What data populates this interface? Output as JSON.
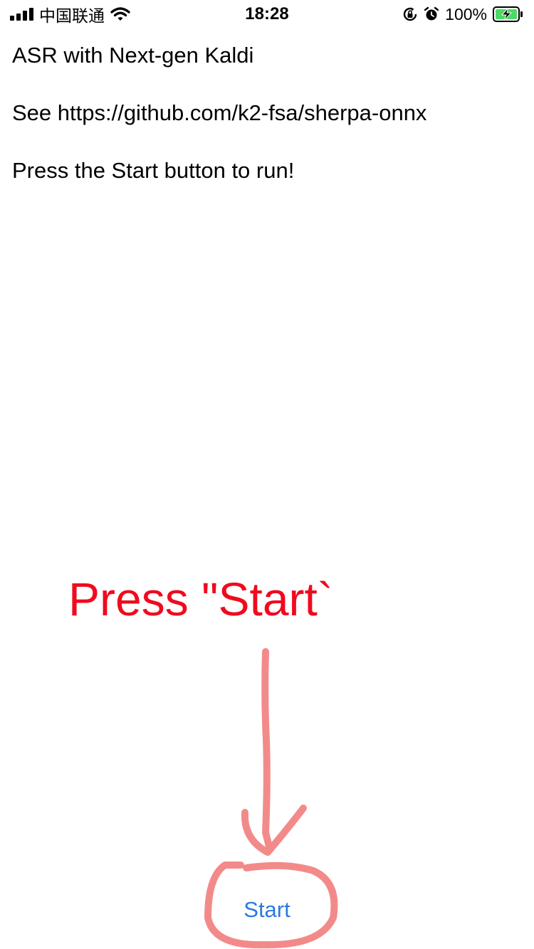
{
  "status_bar": {
    "carrier": "中国联通",
    "time": "18:28",
    "battery_percent": "100%",
    "icons": [
      "signal-bars-icon",
      "wifi-icon",
      "orientation-lock-icon",
      "alarm-icon",
      "battery-charging-icon"
    ]
  },
  "content": {
    "title": "ASR with Next-gen Kaldi",
    "link_line": "See https://github.com/k2-fsa/sherpa-onnx",
    "instruction": "Press the Start button to run!"
  },
  "annotation": {
    "text": "Press \"Start`",
    "color": "#f00a1e",
    "stroke_color": "#f38a8a"
  },
  "start_button": {
    "label": "Start",
    "color": "#2a7ae2"
  }
}
